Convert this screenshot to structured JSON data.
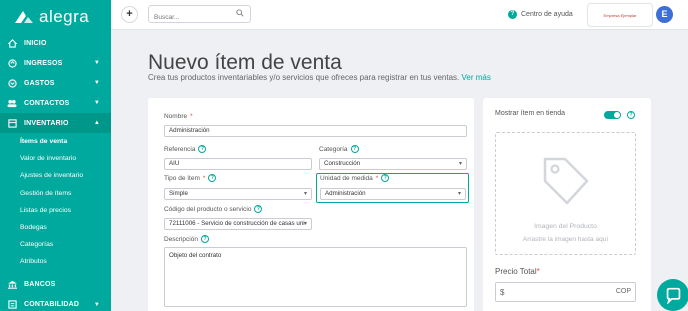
{
  "brand": {
    "name": "alegra"
  },
  "sidebar": {
    "items": [
      {
        "label": "INICIO",
        "icon": "home-icon"
      },
      {
        "label": "INGRESOS",
        "icon": "income-icon"
      },
      {
        "label": "GASTOS",
        "icon": "expenses-icon"
      },
      {
        "label": "CONTACTOS",
        "icon": "contacts-icon"
      },
      {
        "label": "INVENTARIO",
        "icon": "inventory-icon"
      }
    ],
    "inventory_sub": [
      "Ítems de venta",
      "Valor de inventario",
      "Ajustes de inventario",
      "Gestión de ítems",
      "Listas de precios",
      "Bodegas",
      "Categorías",
      "Atributos"
    ],
    "bottom_items": [
      {
        "label": "BANCOS",
        "icon": "bank-icon"
      },
      {
        "label": "CONTABILIDAD",
        "icon": "accounting-icon"
      }
    ]
  },
  "topbar": {
    "search_placeholder": "Buscar...",
    "help_label": "Centro de ayuda",
    "company_name": "Empresa Ejemplar",
    "avatar_letter": "E"
  },
  "page": {
    "title": "Nuevo ítem de venta",
    "subtitle": "Crea tus productos inventariables y/o servicios que ofreces para registrar en tus ventas.",
    "more_link": "Ver más"
  },
  "form": {
    "nombre_label": "Nombre",
    "nombre_value": "Administración",
    "referencia_label": "Referencia",
    "referencia_value": "AIU",
    "categoria_label": "Categoría",
    "categoria_value": "Construcción",
    "tipo_label": "Tipo de ítem",
    "tipo_value": "Simple",
    "unidad_label": "Unidad de medida",
    "unidad_value": "Administración",
    "codigo_label": "Código del producto o servicio",
    "codigo_value": "72111006 - Servicio de construcción de casas uni",
    "descripcion_label": "Descripción",
    "descripcion_value": "Objeto del contrato",
    "required_mark": "*",
    "help_mark": "?"
  },
  "right_panel": {
    "show_store_label": "Mostrar ítem en tienda",
    "image_title": "Imagen del Producto",
    "image_hint": "Arrastre la imagen hasta aquí",
    "price_label": "Precio Total",
    "currency_symbol": "$",
    "currency_code": "COP"
  },
  "colors": {
    "brand": "#00a99d",
    "avatar": "#3d6fd6"
  }
}
